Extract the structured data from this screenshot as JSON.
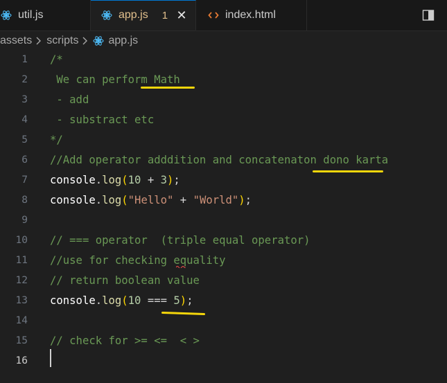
{
  "tabs": [
    {
      "label": "util.js",
      "icon": "javascript-file-icon",
      "state": "normal"
    },
    {
      "label": "app.js",
      "icon": "react-file-icon",
      "state": "modified-active",
      "badge": "1",
      "close": "✕"
    },
    {
      "label": "index.html",
      "icon": "html-file-icon",
      "state": "normal"
    }
  ],
  "breadcrumb": {
    "items": [
      "assets",
      "scripts",
      "app.js"
    ]
  },
  "editor": {
    "line_numbers": [
      "1",
      "2",
      "3",
      "4",
      "5",
      "6",
      "7",
      "8",
      "9",
      "10",
      "11",
      "12",
      "13",
      "14",
      "15",
      "16"
    ],
    "lines": [
      "/*",
      " We can perform Math",
      " - add",
      " - substract etc",
      "*/",
      "//Add operator adddition and concatenaton dono karta",
      "console.log(10 + 3);",
      "console.log(\"Hello\" + \"World\");",
      "",
      "// === operator  (triple equal operator)",
      "//use for checking equality",
      "// return boolean value",
      "console.log(10 === 5);",
      "",
      "// check for >= <=  < >",
      ""
    ],
    "current_line": "16"
  },
  "colors": {
    "comment": "#6a9955",
    "function": "#dcdcaa",
    "number": "#b5cea8",
    "string": "#ce9178",
    "bracket": "#ffd700",
    "highlight_marker": "#f5d60b"
  }
}
